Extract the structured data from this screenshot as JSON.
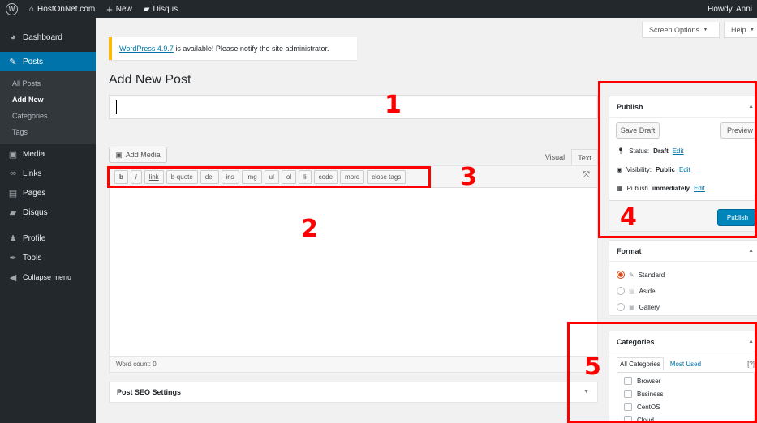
{
  "adminbar": {
    "site_name": "HostOnNet.com",
    "new_label": "New",
    "disqus_label": "Disqus",
    "howdy": "Howdy, Anni"
  },
  "sidebar": {
    "dashboard": "Dashboard",
    "posts": "Posts",
    "submenu": [
      "All Posts",
      "Add New",
      "Categories",
      "Tags"
    ],
    "media": "Media",
    "links": "Links",
    "pages": "Pages",
    "disqus": "Disqus",
    "profile": "Profile",
    "tools": "Tools",
    "collapse": "Collapse menu"
  },
  "screen_options": "Screen Options",
  "help": "Help",
  "notice": {
    "link_text": "WordPress 4.9.7",
    "rest": " is available! Please notify the site administrator."
  },
  "page_title": "Add New Post",
  "editor": {
    "add_media": "Add Media",
    "tab_visual": "Visual",
    "tab_text": "Text",
    "quicktags": [
      "b",
      "i",
      "link",
      "b-quote",
      "del",
      "ins",
      "img",
      "ul",
      "ol",
      "li",
      "code",
      "more",
      "close tags"
    ],
    "word_count": "Word count: 0"
  },
  "seo_title": "Post SEO Settings",
  "publish": {
    "title": "Publish",
    "save_draft": "Save Draft",
    "preview": "Preview",
    "status_label": "Status:",
    "status_value": "Draft",
    "visibility_label": "Visibility:",
    "visibility_value": "Public",
    "publish_label": "Publish",
    "publish_value": "immediately",
    "edit": "Edit",
    "publish_button": "Publish"
  },
  "format": {
    "title": "Format",
    "options": [
      "Standard",
      "Aside",
      "Gallery"
    ]
  },
  "categories": {
    "title": "Categories",
    "tab_all": "All Categories",
    "tab_used": "Most Used",
    "help": "[?]",
    "items": [
      "Browser",
      "Business",
      "CentOS",
      "Cloud"
    ]
  },
  "annotations": [
    "1",
    "2",
    "3",
    "4",
    "5"
  ],
  "colors": {
    "admin_dark": "#23282d",
    "accent_blue": "#0073aa",
    "annotation_red": "#ff0000",
    "notice_yellow": "#ffb900"
  }
}
